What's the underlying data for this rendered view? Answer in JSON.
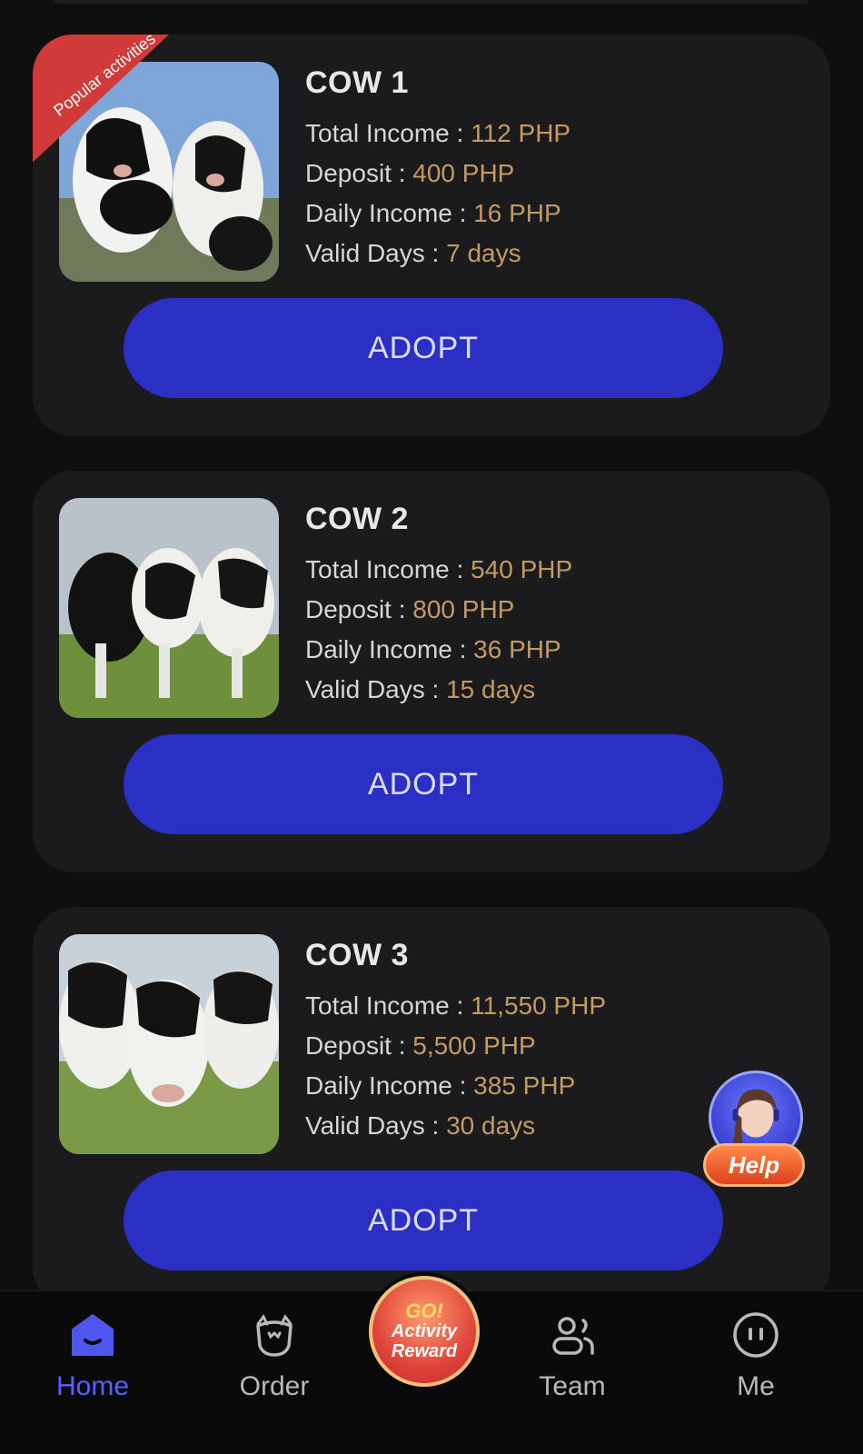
{
  "badge": {
    "text": "Popular activities"
  },
  "products": [
    {
      "name": "COW 1",
      "rows": [
        {
          "label": "Total Income : ",
          "value": "112 PHP"
        },
        {
          "label": "Deposit : ",
          "value": "400 PHP"
        },
        {
          "label": "Daily Income : ",
          "value": "16 PHP"
        },
        {
          "label": "Valid Days : ",
          "value": "7 days"
        }
      ],
      "button": "ADOPT"
    },
    {
      "name": "COW 2",
      "rows": [
        {
          "label": "Total Income : ",
          "value": "540 PHP"
        },
        {
          "label": "Deposit : ",
          "value": "800 PHP"
        },
        {
          "label": "Daily Income : ",
          "value": "36 PHP"
        },
        {
          "label": "Valid Days : ",
          "value": "15 days"
        }
      ],
      "button": "ADOPT"
    },
    {
      "name": "COW 3",
      "rows": [
        {
          "label": "Total Income : ",
          "value": "11,550 PHP"
        },
        {
          "label": "Deposit : ",
          "value": "5,500 PHP"
        },
        {
          "label": "Daily Income : ",
          "value": "385 PHP"
        },
        {
          "label": "Valid Days : ",
          "value": "30 days"
        }
      ],
      "button": "ADOPT"
    }
  ],
  "help": {
    "label": "Help"
  },
  "tabbar": {
    "home": "Home",
    "order": "Order",
    "center_top": "GO!",
    "center_bottom": "Activity Reward",
    "team": "Team",
    "me": "Me"
  },
  "colors": {
    "accent": "#2b2fc4",
    "value": "#c49a62",
    "card": "#1b1b1e",
    "active_tab": "#5860ff"
  }
}
